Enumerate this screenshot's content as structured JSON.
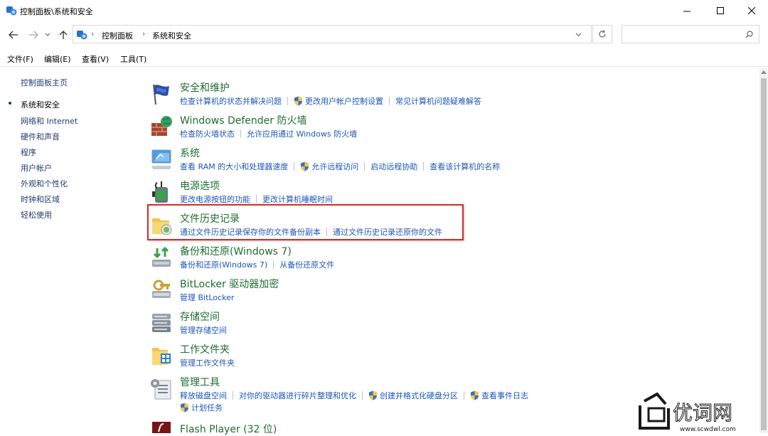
{
  "window": {
    "title": "控制面板\\系统和安全",
    "minimize": "—",
    "maximize": "☐",
    "close": "✕"
  },
  "address": {
    "crumbs": [
      "控制面板",
      "系统和安全"
    ],
    "separator": "›",
    "search_placeholder": ""
  },
  "menu": [
    "文件(F)",
    "编辑(E)",
    "查看(V)",
    "工具(T)"
  ],
  "sidebar": {
    "home": "控制面板主页",
    "items": [
      "系统和安全",
      "网络和 Internet",
      "硬件和声音",
      "程序",
      "用户帐户",
      "外观和个性化",
      "时钟和区域",
      "轻松使用"
    ]
  },
  "categories": [
    {
      "title": "安全和维护",
      "links": [
        "检查计算机的状态并解决问题",
        "更改用户帐户控制设置",
        "常见计算机问题疑难解答"
      ]
    },
    {
      "title": "Windows Defender 防火墙",
      "links": [
        "检查防火墙状态",
        "允许应用通过 Windows 防火墙"
      ]
    },
    {
      "title": "系统",
      "links": [
        "查看 RAM 的大小和处理器速度",
        "允许远程访问",
        "启动远程协助",
        "查看该计算机的名称"
      ]
    },
    {
      "title": "电源选项",
      "links": [
        "更改电源按钮的功能",
        "更改计算机睡眠时间"
      ]
    },
    {
      "title": "文件历史记录",
      "links": [
        "通过文件历史记录保存你的文件备份副本",
        "通过文件历史记录还原你的文件"
      ]
    },
    {
      "title": "备份和还原(Windows 7)",
      "links": [
        "备份和还原(Windows 7)",
        "从备份还原文件"
      ]
    },
    {
      "title": "BitLocker 驱动器加密",
      "links": [
        "管理 BitLocker"
      ]
    },
    {
      "title": "存储空间",
      "links": [
        "管理存储空间"
      ]
    },
    {
      "title": "工作文件夹",
      "links": [
        "管理工作文件夹"
      ]
    },
    {
      "title": "管理工具",
      "links": [
        "释放磁盘空间",
        "对你的驱动器进行碎片整理和优化",
        "创建并格式化硬盘分区",
        "查看事件日志"
      ],
      "links2": [
        "计划任务"
      ]
    },
    {
      "title": "Flash Player (32 位)",
      "links": []
    }
  ],
  "watermark": {
    "text": "优词网",
    "url": "www.scwdwl.com"
  }
}
